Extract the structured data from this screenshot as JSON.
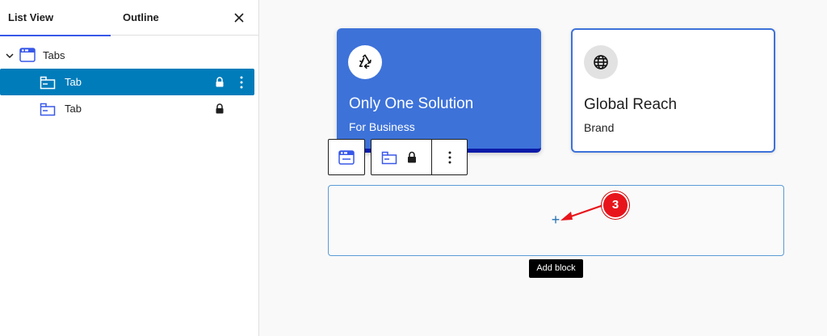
{
  "sidebar": {
    "tabs": [
      {
        "label": "List View",
        "active": true
      },
      {
        "label": "Outline",
        "active": false
      }
    ],
    "close_icon": "close-icon",
    "tree": [
      {
        "label": "Tabs",
        "icon": "tabs-block-icon",
        "expanded": true
      },
      {
        "label": "Tab",
        "icon": "tab-block-icon",
        "locked": true,
        "selected": true
      },
      {
        "label": "Tab",
        "icon": "tab-block-icon",
        "locked": true,
        "selected": false
      }
    ]
  },
  "canvas": {
    "cards": [
      {
        "title": "Only One Solution",
        "subtitle": "For Business",
        "icon": "recycle-icon",
        "background": "#3d72d9"
      },
      {
        "title": "Global Reach",
        "subtitle": "Brand",
        "icon": "globe-icon",
        "background": "#ffffff"
      }
    ],
    "toolbar": {
      "parent_icon": "tabs-block-icon",
      "block_icon": "tab-block-icon",
      "lock_icon": "lock-icon",
      "more_icon": "more-vertical-icon"
    },
    "appender": {
      "symbol": "+",
      "tooltip": "Add block"
    },
    "annotation": {
      "step": "3",
      "color": "#e8141b"
    }
  },
  "colors": {
    "accent": "#3858e9",
    "selection": "#007cba",
    "focus_border": "#5a9bd4"
  }
}
